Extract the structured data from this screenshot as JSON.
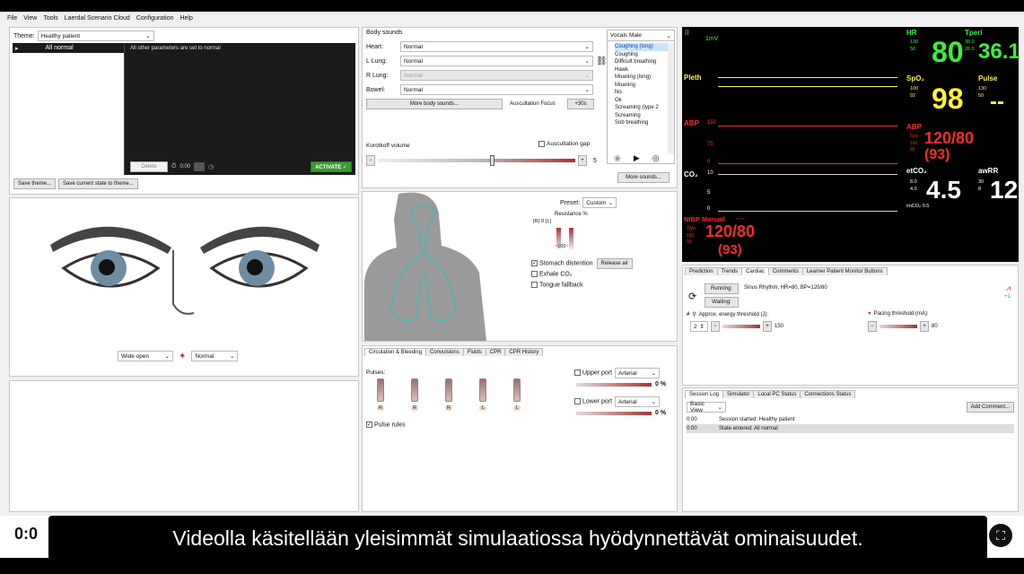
{
  "menu": [
    "File",
    "View",
    "Tools",
    "Laerdal Scenario Cloud",
    "Configuration",
    "Help"
  ],
  "theme": {
    "label": "Theme:",
    "value": "Healthy patient",
    "tree_item": "All normal",
    "description": "All other parameters are set to normal",
    "delete": "Delete",
    "time": "0:00",
    "activate": "ACTIVATE ✓",
    "save_theme": "Save theme...",
    "save_state": "Save current state to theme..."
  },
  "eyes": {
    "lid_value": "Wide open",
    "pupil_value": "Normal"
  },
  "body_sounds": {
    "title": "Body sounds",
    "rows": [
      {
        "label": "Heart:",
        "value": "Normal"
      },
      {
        "label": "L Lung:",
        "value": "Normal"
      },
      {
        "label": "R Lung:",
        "value": "Normal"
      },
      {
        "label": "Bowel:",
        "value": "Normal"
      }
    ],
    "more": "More body sounds...",
    "focus": "Auscultation Focus",
    "focus_time": "+30s",
    "korotkoff": "Korotkoff volume",
    "gap": "Auscultation gap",
    "vol_value": "5"
  },
  "vocals": {
    "title": "Vocals Male",
    "items": [
      "Coughing (long)",
      "Coughing",
      "Difficult breathing",
      "Hawk",
      "Moaning (long)",
      "Moaning",
      "No",
      "Ok",
      "Screaming (type 2",
      "Screaming",
      "Sob breathing"
    ],
    "more": "More sounds..."
  },
  "airway": {
    "preset_label": "Preset:",
    "preset_value": "Custom",
    "resistance": "Resistance %",
    "r_left": "[R]",
    "r_zero": "0",
    "r_right": "[L]",
    "r_hundred": "~100~",
    "stomach": "Stomach distention",
    "release": "Release air",
    "exhale": "Exhale CO₂",
    "tongue": "Tongue fallback"
  },
  "circ": {
    "tabs": [
      "Circulation & Bleeding",
      "Convulsions",
      "Fluids",
      "CPR",
      "CPR History"
    ],
    "pulses": "Pulses:",
    "pulse_labels": [
      "R",
      "R",
      "R",
      "L",
      "L"
    ],
    "pulse_rules": "Pulse rules",
    "upper": "Upper port",
    "lower": "Lower port",
    "arterial": "Arterial",
    "pct": "0 %"
  },
  "monitor": {
    "ii": "II",
    "mv": "1mV",
    "pleth": "Pleth",
    "abp": "ABP",
    "abp_150": "150",
    "abp_75": "75",
    "abp_0": "0",
    "co2": "CO₂",
    "co2_10": "10",
    "co2_5": "5",
    "co2_0": "0",
    "hr": {
      "label": "HR",
      "hi": "130",
      "lo": "50",
      "value": "80"
    },
    "tperi": {
      "label": "Tperi",
      "hi": "38.0",
      "lo": "26.0",
      "value": "36.1"
    },
    "spo2": {
      "label": "SpO₂",
      "hi": "100",
      "lo": "92",
      "value": "98"
    },
    "pulse": {
      "label": "Pulse",
      "hi": "130",
      "lo": "50",
      "value": "--"
    },
    "abp_num": {
      "label": "ABP",
      "sys": "Sys.",
      "hi": "160",
      "lo": "90",
      "value": "120/80",
      "mean": "(93)"
    },
    "etco2": {
      "label": "etCO₂",
      "hi": "8.0",
      "lo": "4.0",
      "value": "4.5",
      "ico2": "imCO₂ 0.5"
    },
    "awrr": {
      "label": "awRR",
      "hi": "30",
      "lo": "8",
      "value": "12"
    },
    "nibp": {
      "label": "NIBP Manual",
      "dash": "--:--",
      "sys": "Sys.",
      "hi": "160",
      "lo": "90",
      "value": "120/80",
      "mean": "(93)"
    }
  },
  "cardiac": {
    "tabs": [
      "Prediction",
      "Trends",
      "Cardiac",
      "Comments",
      "Learner Patient Monitor Buttons"
    ],
    "running": "Running:",
    "rhythm": "Sinus Rhythm, HR=80, BP=120/80",
    "waiting": "Waiting:",
    "energy": "Approx. energy threshold (J):",
    "energy_val": "150",
    "stepper": "2",
    "pacing": "Pacing threshold (mA):",
    "pacing_val": "80",
    "plus1": "+1"
  },
  "log": {
    "tabs": [
      "Session Log",
      "Simulator",
      "Local PC Status",
      "Connections Status"
    ],
    "view": "Basic View",
    "add": "Add Comment...",
    "rows": [
      {
        "time": "0:00",
        "text": "Session started: Healthy patient"
      },
      {
        "time": "0:00",
        "text": "State entered: All normal"
      }
    ]
  },
  "clock": "0:0",
  "subtitle": "Videolla käsitellään yleisimmät simulaatiossa hyödynnettävät ominaisuudet."
}
